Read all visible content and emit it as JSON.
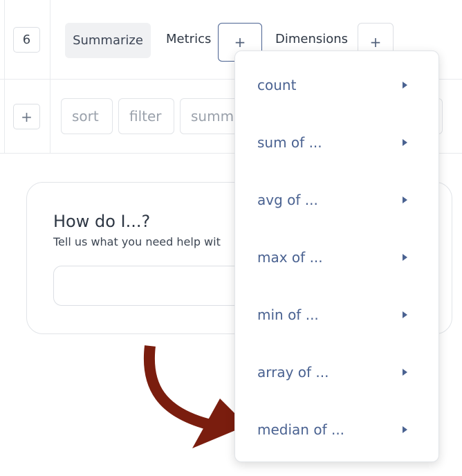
{
  "step": {
    "number": "6",
    "add_symbol": "+"
  },
  "toolbar": {
    "summarize_label": "Summarize",
    "metrics_label": "Metrics",
    "metrics_add": "+",
    "dimensions_label": "Dimensions",
    "dimensions_add": "+"
  },
  "actions": {
    "add_symbol": "+",
    "chips": [
      "sort",
      "filter",
      "summ"
    ]
  },
  "help": {
    "title": "How do I...?",
    "subtitle": "Tell us what you need help wit"
  },
  "metrics_menu": {
    "items": [
      {
        "label": "count"
      },
      {
        "label": "sum of ..."
      },
      {
        "label": "avg of ..."
      },
      {
        "label": "max of ..."
      },
      {
        "label": "min of ..."
      },
      {
        "label": "array of ..."
      },
      {
        "label": "median of ..."
      }
    ]
  },
  "colors": {
    "accent": "#4a6291",
    "arrow": "#7a1d0e",
    "border": "#dcdfe4"
  }
}
